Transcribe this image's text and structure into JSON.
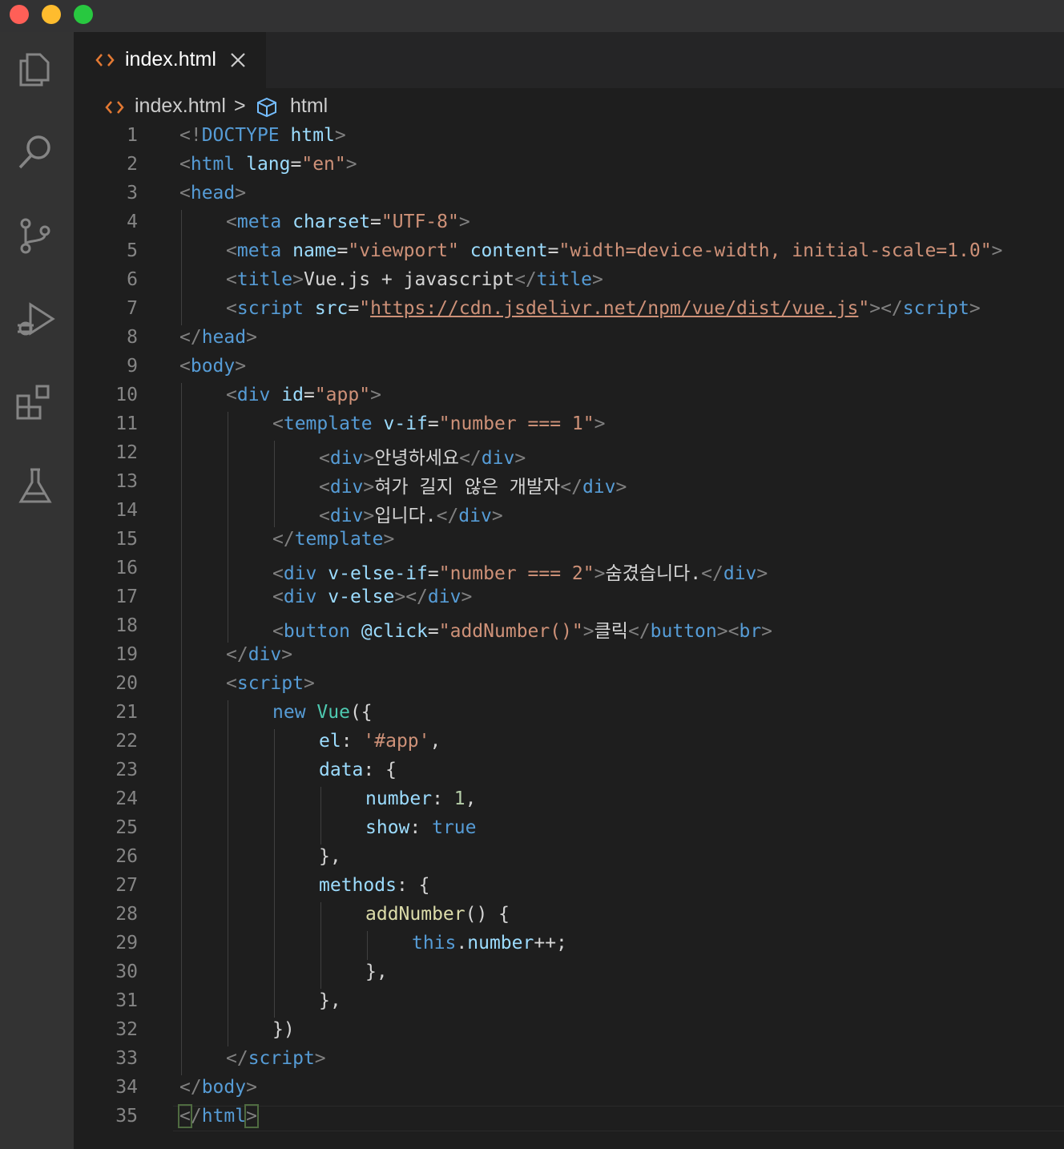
{
  "window": {
    "buttons": [
      "close",
      "minimize",
      "maximize"
    ]
  },
  "activity_bar": {
    "items": [
      "explorer-icon",
      "search-icon",
      "source-control-icon",
      "run-debug-icon",
      "extensions-icon",
      "testing-icon"
    ]
  },
  "tab": {
    "label": "index.html",
    "icon": "html-file-icon",
    "close_icon": "close-icon"
  },
  "breadcrumb": {
    "file": "index.html",
    "separator": ">",
    "symbol": "html"
  },
  "colors": {
    "tag": "#569cd6",
    "attribute": "#9cdcfe",
    "string": "#ce9178",
    "bracket": "#808080",
    "class": "#4ec9b0",
    "function": "#dcdcaa",
    "number": "#b5cea8",
    "text": "#d4d4d4",
    "line_number": "#858585"
  },
  "code_lines": [
    {
      "n": "1",
      "indent": 0,
      "tokens": [
        [
          "br",
          "<!"
        ],
        [
          "dt",
          "DOCTYPE"
        ],
        [
          "txt",
          " "
        ],
        [
          "attr",
          "html"
        ],
        [
          "br",
          ">"
        ]
      ]
    },
    {
      "n": "2",
      "indent": 0,
      "tokens": [
        [
          "br",
          "<"
        ],
        [
          "tag",
          "html"
        ],
        [
          "txt",
          " "
        ],
        [
          "attr",
          "lang"
        ],
        [
          "txt",
          "="
        ],
        [
          "str",
          "\"en\""
        ],
        [
          "br",
          ">"
        ]
      ]
    },
    {
      "n": "3",
      "indent": 0,
      "tokens": [
        [
          "br",
          "<"
        ],
        [
          "tag",
          "head"
        ],
        [
          "br",
          ">"
        ]
      ]
    },
    {
      "n": "4",
      "indent": 1,
      "tokens": [
        [
          "br",
          "<"
        ],
        [
          "tag",
          "meta"
        ],
        [
          "txt",
          " "
        ],
        [
          "attr",
          "charset"
        ],
        [
          "txt",
          "="
        ],
        [
          "str",
          "\"UTF-8\""
        ],
        [
          "br",
          ">"
        ]
      ]
    },
    {
      "n": "5",
      "indent": 1,
      "tokens": [
        [
          "br",
          "<"
        ],
        [
          "tag",
          "meta"
        ],
        [
          "txt",
          " "
        ],
        [
          "attr",
          "name"
        ],
        [
          "txt",
          "="
        ],
        [
          "str",
          "\"viewport\""
        ],
        [
          "txt",
          " "
        ],
        [
          "attr",
          "content"
        ],
        [
          "txt",
          "="
        ],
        [
          "str",
          "\"width=device-width, initial-scale=1.0\""
        ],
        [
          "br",
          ">"
        ]
      ]
    },
    {
      "n": "6",
      "indent": 1,
      "tokens": [
        [
          "br",
          "<"
        ],
        [
          "tag",
          "title"
        ],
        [
          "br",
          ">"
        ],
        [
          "txt",
          "Vue.js + javascript"
        ],
        [
          "br",
          "</"
        ],
        [
          "tag",
          "title"
        ],
        [
          "br",
          ">"
        ]
      ]
    },
    {
      "n": "7",
      "indent": 1,
      "tokens": [
        [
          "br",
          "<"
        ],
        [
          "tag",
          "script"
        ],
        [
          "txt",
          " "
        ],
        [
          "attr",
          "src"
        ],
        [
          "txt",
          "="
        ],
        [
          "str",
          "\""
        ],
        [
          "url",
          "https://cdn.jsdelivr.net/npm/vue/dist/vue.js"
        ],
        [
          "str",
          "\""
        ],
        [
          "br",
          "></"
        ],
        [
          "tag",
          "script"
        ],
        [
          "br",
          ">"
        ]
      ]
    },
    {
      "n": "8",
      "indent": 0,
      "tokens": [
        [
          "br",
          "</"
        ],
        [
          "tag",
          "head"
        ],
        [
          "br",
          ">"
        ]
      ]
    },
    {
      "n": "9",
      "indent": 0,
      "tokens": [
        [
          "br",
          "<"
        ],
        [
          "tag",
          "body"
        ],
        [
          "br",
          ">"
        ]
      ]
    },
    {
      "n": "10",
      "indent": 1,
      "tokens": [
        [
          "br",
          "<"
        ],
        [
          "tag",
          "div"
        ],
        [
          "txt",
          " "
        ],
        [
          "attr",
          "id"
        ],
        [
          "txt",
          "="
        ],
        [
          "str",
          "\"app\""
        ],
        [
          "br",
          ">"
        ]
      ]
    },
    {
      "n": "11",
      "indent": 2,
      "tokens": [
        [
          "br",
          "<"
        ],
        [
          "tag",
          "template"
        ],
        [
          "txt",
          " "
        ],
        [
          "attr",
          "v-if"
        ],
        [
          "txt",
          "="
        ],
        [
          "str",
          "\"number === 1\""
        ],
        [
          "br",
          ">"
        ]
      ]
    },
    {
      "n": "12",
      "indent": 3,
      "tokens": [
        [
          "br",
          "<"
        ],
        [
          "tag",
          "div"
        ],
        [
          "br",
          ">"
        ],
        [
          "txt",
          "안녕하세요"
        ],
        [
          "br",
          "</"
        ],
        [
          "tag",
          "div"
        ],
        [
          "br",
          ">"
        ]
      ]
    },
    {
      "n": "13",
      "indent": 3,
      "tokens": [
        [
          "br",
          "<"
        ],
        [
          "tag",
          "div"
        ],
        [
          "br",
          ">"
        ],
        [
          "txt",
          "혀가 길지 않은 개발자"
        ],
        [
          "br",
          "</"
        ],
        [
          "tag",
          "div"
        ],
        [
          "br",
          ">"
        ]
      ]
    },
    {
      "n": "14",
      "indent": 3,
      "tokens": [
        [
          "br",
          "<"
        ],
        [
          "tag",
          "div"
        ],
        [
          "br",
          ">"
        ],
        [
          "txt",
          "입니다."
        ],
        [
          "br",
          "</"
        ],
        [
          "tag",
          "div"
        ],
        [
          "br",
          ">"
        ]
      ]
    },
    {
      "n": "15",
      "indent": 2,
      "tokens": [
        [
          "br",
          "</"
        ],
        [
          "tag",
          "template"
        ],
        [
          "br",
          ">"
        ]
      ]
    },
    {
      "n": "16",
      "indent": 2,
      "tokens": [
        [
          "br",
          "<"
        ],
        [
          "tag",
          "div"
        ],
        [
          "txt",
          " "
        ],
        [
          "attr",
          "v-else-if"
        ],
        [
          "txt",
          "="
        ],
        [
          "str",
          "\"number === 2\""
        ],
        [
          "br",
          ">"
        ],
        [
          "txt",
          "숨겼습니다."
        ],
        [
          "br",
          "</"
        ],
        [
          "tag",
          "div"
        ],
        [
          "br",
          ">"
        ]
      ]
    },
    {
      "n": "17",
      "indent": 2,
      "tokens": [
        [
          "br",
          "<"
        ],
        [
          "tag",
          "div"
        ],
        [
          "txt",
          " "
        ],
        [
          "attr",
          "v-else"
        ],
        [
          "br",
          "></"
        ],
        [
          "tag",
          "div"
        ],
        [
          "br",
          ">"
        ]
      ]
    },
    {
      "n": "18",
      "indent": 2,
      "tokens": [
        [
          "br",
          "<"
        ],
        [
          "tag",
          "button"
        ],
        [
          "txt",
          " "
        ],
        [
          "attr",
          "@click"
        ],
        [
          "txt",
          "="
        ],
        [
          "str",
          "\"addNumber()\""
        ],
        [
          "br",
          ">"
        ],
        [
          "txt",
          "클릭"
        ],
        [
          "br",
          "</"
        ],
        [
          "tag",
          "button"
        ],
        [
          "br",
          "><"
        ],
        [
          "tag",
          "br"
        ],
        [
          "br",
          ">"
        ]
      ]
    },
    {
      "n": "19",
      "indent": 1,
      "tokens": [
        [
          "br",
          "</"
        ],
        [
          "tag",
          "div"
        ],
        [
          "br",
          ">"
        ]
      ]
    },
    {
      "n": "20",
      "indent": 1,
      "tokens": [
        [
          "br",
          "<"
        ],
        [
          "tag",
          "script"
        ],
        [
          "br",
          ">"
        ]
      ]
    },
    {
      "n": "21",
      "indent": 2,
      "tokens": [
        [
          "kw",
          "new"
        ],
        [
          "txt",
          " "
        ],
        [
          "cls",
          "Vue"
        ],
        [
          "punc",
          "({"
        ]
      ]
    },
    {
      "n": "22",
      "indent": 3,
      "tokens": [
        [
          "prop",
          "el"
        ],
        [
          "punc",
          ": "
        ],
        [
          "str",
          "'#app'"
        ],
        [
          "punc",
          ","
        ]
      ]
    },
    {
      "n": "23",
      "indent": 3,
      "tokens": [
        [
          "prop",
          "data"
        ],
        [
          "punc",
          ": {"
        ]
      ]
    },
    {
      "n": "24",
      "indent": 4,
      "tokens": [
        [
          "prop",
          "number"
        ],
        [
          "punc",
          ": "
        ],
        [
          "num",
          "1"
        ],
        [
          "punc",
          ","
        ]
      ]
    },
    {
      "n": "25",
      "indent": 4,
      "tokens": [
        [
          "prop",
          "show"
        ],
        [
          "punc",
          ": "
        ],
        [
          "kw",
          "true"
        ]
      ]
    },
    {
      "n": "26",
      "indent": 3,
      "tokens": [
        [
          "punc",
          "},"
        ]
      ]
    },
    {
      "n": "27",
      "indent": 3,
      "tokens": [
        [
          "prop",
          "methods"
        ],
        [
          "punc",
          ": {"
        ]
      ]
    },
    {
      "n": "28",
      "indent": 4,
      "tokens": [
        [
          "fn",
          "addNumber"
        ],
        [
          "punc",
          "() {"
        ]
      ]
    },
    {
      "n": "29",
      "indent": 5,
      "tokens": [
        [
          "kw",
          "this"
        ],
        [
          "punc",
          "."
        ],
        [
          "prop",
          "number"
        ],
        [
          "punc",
          "++;"
        ]
      ]
    },
    {
      "n": "30",
      "indent": 4,
      "tokens": [
        [
          "punc",
          "},"
        ]
      ]
    },
    {
      "n": "31",
      "indent": 3,
      "tokens": [
        [
          "punc",
          "},"
        ]
      ]
    },
    {
      "n": "32",
      "indent": 2,
      "tokens": [
        [
          "punc",
          "})"
        ]
      ]
    },
    {
      "n": "33",
      "indent": 1,
      "tokens": [
        [
          "br",
          "</"
        ],
        [
          "tag",
          "script"
        ],
        [
          "br",
          ">"
        ]
      ]
    },
    {
      "n": "34",
      "indent": 0,
      "tokens": [
        [
          "br",
          "</"
        ],
        [
          "tag",
          "body"
        ],
        [
          "br",
          ">"
        ]
      ]
    },
    {
      "n": "35",
      "indent": 0,
      "tokens": [
        [
          "brk",
          "<"
        ],
        [
          "br",
          "/"
        ],
        [
          "tag",
          "html"
        ],
        [
          "brk",
          ">"
        ]
      ]
    }
  ],
  "guides": [
    [],
    [],
    [],
    [
      0
    ],
    [
      0
    ],
    [
      0
    ],
    [
      0
    ],
    [],
    [],
    [
      0
    ],
    [
      0,
      1
    ],
    [
      0,
      1,
      2
    ],
    [
      0,
      1,
      2
    ],
    [
      0,
      1,
      2
    ],
    [
      0,
      1
    ],
    [
      0,
      1
    ],
    [
      0,
      1
    ],
    [
      0,
      1
    ],
    [
      0
    ],
    [
      0
    ],
    [
      0,
      1
    ],
    [
      0,
      1,
      2
    ],
    [
      0,
      1,
      2
    ],
    [
      0,
      1,
      2,
      3
    ],
    [
      0,
      1,
      2,
      3
    ],
    [
      0,
      1,
      2
    ],
    [
      0,
      1,
      2
    ],
    [
      0,
      1,
      2,
      3
    ],
    [
      0,
      1,
      2,
      3,
      4
    ],
    [
      0,
      1,
      2,
      3
    ],
    [
      0,
      1,
      2
    ],
    [
      0,
      1
    ],
    [
      0
    ],
    [],
    []
  ]
}
